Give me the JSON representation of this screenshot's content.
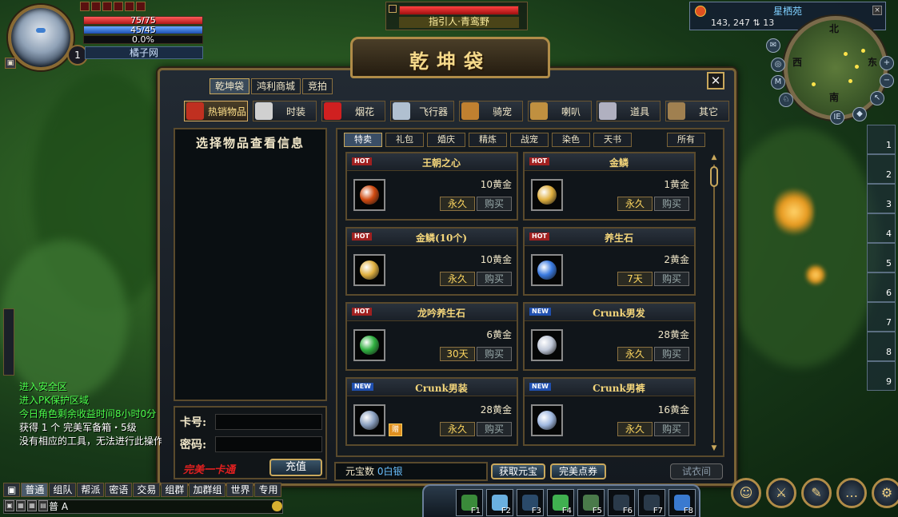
{
  "player": {
    "hp_text": "75/75",
    "mp_text": "45/45",
    "xp_text": "0.0%",
    "hp_fraction": 1.0,
    "mp_fraction": 1.0,
    "xp_fraction": 0.0,
    "level": "1",
    "name": "橘子网"
  },
  "target": {
    "name": "指引人·青鸾野"
  },
  "zone": {
    "name": "星栖苑",
    "coords": "143, 247",
    "coord_extra": "13"
  },
  "compass": {
    "north": "北",
    "south": "南",
    "west": "西",
    "east": "东"
  },
  "minimap_label": "IE",
  "right_bar": [
    "1",
    "2",
    "3",
    "4",
    "5",
    "6",
    "7",
    "8",
    "9"
  ],
  "shop": {
    "title": "乾坤袋",
    "top_tabs": [
      "乾坤袋",
      "鸿利商城",
      "竞拍"
    ],
    "active_top_tab": 0,
    "categories": [
      {
        "label": "热销物品",
        "icon": "gift-icon",
        "color": "#c03020"
      },
      {
        "label": "时装",
        "icon": "fashion-icon",
        "color": "#d0d0d0"
      },
      {
        "label": "烟花",
        "icon": "firework-icon",
        "color": "#d02020"
      },
      {
        "label": "飞行器",
        "icon": "sword-icon",
        "color": "#b0c0d0"
      },
      {
        "label": "骑宠",
        "icon": "mount-icon",
        "color": "#c08030"
      },
      {
        "label": "喇叭",
        "icon": "horn-icon",
        "color": "#c09040"
      },
      {
        "label": "道具",
        "icon": "tool-icon",
        "color": "#b0b0c0"
      },
      {
        "label": "其它",
        "icon": "scroll-icon",
        "color": "#a08050"
      }
    ],
    "active_category": 0,
    "info_title": "选择物品查看信息",
    "sub_tabs": [
      "特卖",
      "礼包",
      "婚庆",
      "精炼",
      "战宠",
      "染色",
      "天书"
    ],
    "sub_all": "所有",
    "active_sub_tab": 0,
    "items": [
      {
        "tag": "HOT",
        "name": "王朝之心",
        "price": "10黄金",
        "duration": "永久",
        "buy": "购买",
        "icon": "heart-gem-icon",
        "color": "#d04a10"
      },
      {
        "tag": "HOT",
        "name": "金鳞",
        "price": "1黄金",
        "duration": "永久",
        "buy": "购买",
        "icon": "gold-scale-icon",
        "color": "#e0b040"
      },
      {
        "tag": "HOT",
        "name": "金鳞(10个)",
        "price": "10黄金",
        "duration": "永久",
        "buy": "购买",
        "icon": "gold-scale-icon",
        "color": "#e0b040"
      },
      {
        "tag": "HOT",
        "name": "养生石",
        "price": "2黄金",
        "duration": "7天",
        "buy": "购买",
        "icon": "blue-orb-icon",
        "color": "#3a7ae0"
      },
      {
        "tag": "HOT",
        "name": "龙吟养生石",
        "price": "6黄金",
        "duration": "30天",
        "buy": "购买",
        "icon": "green-orb-icon",
        "color": "#30b040"
      },
      {
        "tag": "NEW",
        "name": "Crunk男发",
        "price": "28黄金",
        "duration": "永久",
        "buy": "购买",
        "icon": "hair-icon",
        "color": "#c0c8d8"
      },
      {
        "tag": "NEW",
        "name": "Crunk男装",
        "price": "28黄金",
        "duration": "永久",
        "buy": "购买",
        "icon": "outfit-icon",
        "color": "#8aa0c0",
        "gift": "赠"
      },
      {
        "tag": "NEW",
        "name": "Crunk男裤",
        "price": "16黄金",
        "duration": "永久",
        "buy": "购买",
        "icon": "pants-icon",
        "color": "#a0b8e0"
      }
    ],
    "card": {
      "number_label": "卡号:",
      "password_label": "密码:",
      "brand": "完美一卡通",
      "recharge": "充值"
    },
    "balance_label": "元宝数",
    "balance_value": "0白银",
    "get_yuanbao": "获取元宝",
    "perfect_points": "完美点券",
    "fitting_room": "试衣间"
  },
  "chat": {
    "lines": [
      {
        "text": "进入安全区",
        "color": "green"
      },
      {
        "text": "进入PK保护区域",
        "color": "green"
      },
      {
        "text": "今日角色剩余收益时间8小时0分",
        "color": "green"
      },
      {
        "text": "获得 1 个 完美军备箱・5级",
        "color": "white"
      },
      {
        "text": "没有相应的工具，无法进行此操作",
        "color": "white"
      }
    ],
    "tabs": [
      "普通",
      "组队",
      "帮派",
      "密语",
      "交易",
      "组群",
      "加群组",
      "世界",
      "专用"
    ],
    "active_tab": 0,
    "input_prefix": "普 A"
  },
  "skillbar": {
    "keys": [
      "F1",
      "F2",
      "F3",
      "F4",
      "F5",
      "F6",
      "F7",
      "F8"
    ]
  },
  "menu_buttons": [
    "character-icon",
    "skills-icon",
    "quest-icon",
    "chat-bubble-icon",
    "settings-icon"
  ]
}
